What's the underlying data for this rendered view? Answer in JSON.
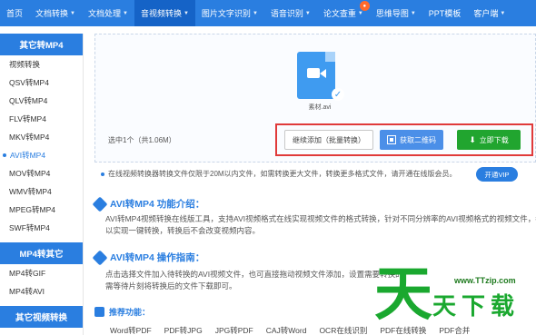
{
  "nav": {
    "items": [
      {
        "label": "首页",
        "caret": false
      },
      {
        "label": "文档转换",
        "caret": true
      },
      {
        "label": "文档处理",
        "caret": true
      },
      {
        "label": "音视频转换",
        "caret": true,
        "active": true
      },
      {
        "label": "图片文字识别",
        "caret": true
      },
      {
        "label": "语音识别",
        "caret": true
      },
      {
        "label": "论文查重",
        "caret": true,
        "badge": "hot"
      },
      {
        "label": "思维导图",
        "caret": true
      },
      {
        "label": "PPT模板",
        "caret": false
      },
      {
        "label": "客户端",
        "caret": true
      }
    ],
    "bg_color": "#2a7ee0",
    "active_color": "#1563c7"
  },
  "sidebar": {
    "section1": {
      "title": "其它转MP4",
      "items": [
        "视频转换",
        "QSV转MP4",
        "QLV转MP4",
        "FLV转MP4",
        "MKV转MP4",
        "AVI转MP4",
        "MOV转MP4",
        "WMV转MP4",
        "MPEG转MP4",
        "SWF转MP4"
      ],
      "active": "AVI转MP4"
    },
    "section2": {
      "title": "MP4转其它",
      "items": [
        "MP4转GIF",
        "MP4转AVI"
      ]
    },
    "section3": {
      "title": "其它视频转换"
    }
  },
  "upload": {
    "file_name": "素材.avi",
    "file_icon": "video-file-icon",
    "status": "选中1个（共1.06M）",
    "buttons": {
      "add": "继续添加（批量转换）",
      "qr": "获取二维码",
      "download": "立即下载"
    }
  },
  "notice": {
    "text": "在线视频转换器转换文件仅限于20M以内文件，如需转换更大文件，转换更多格式文件，请开通在线版会员。",
    "vip_button": "开通VIP"
  },
  "intro": {
    "title": "AVI转MP4 功能介绍：",
    "lines": [
      "AVI转MP4视频转换在线版工具，支持AVI视频格式在线实现视频文件的格式转换，针对不同分辨率的AVI视频格式的视频文件，都可",
      "以实现一键转换，转换后不会改变视频内容。"
    ]
  },
  "guide": {
    "title": "AVI转MP4 操作指南：",
    "lines": [
      "点击选择文件加入待转换的AVI视频文件，也可直接拖动视频文件添加，设置需要转换的",
      "需等待片刻将转换后的文件下载即可。"
    ]
  },
  "recommend": {
    "title": "推荐功能：",
    "links": [
      "Word转PDF",
      "PDF转JPG",
      "JPG转PDF",
      "CAJ转Word",
      "OCR在线识别",
      "PDF在线转换",
      "PDF合并"
    ]
  },
  "watermark": {
    "url": "www.TTzip.com",
    "big_char": "天",
    "rest": "天下载"
  },
  "colors": {
    "accent": "#2a7ee0",
    "download_green": "#21a52f",
    "highlight_red": "#e03a3a"
  }
}
